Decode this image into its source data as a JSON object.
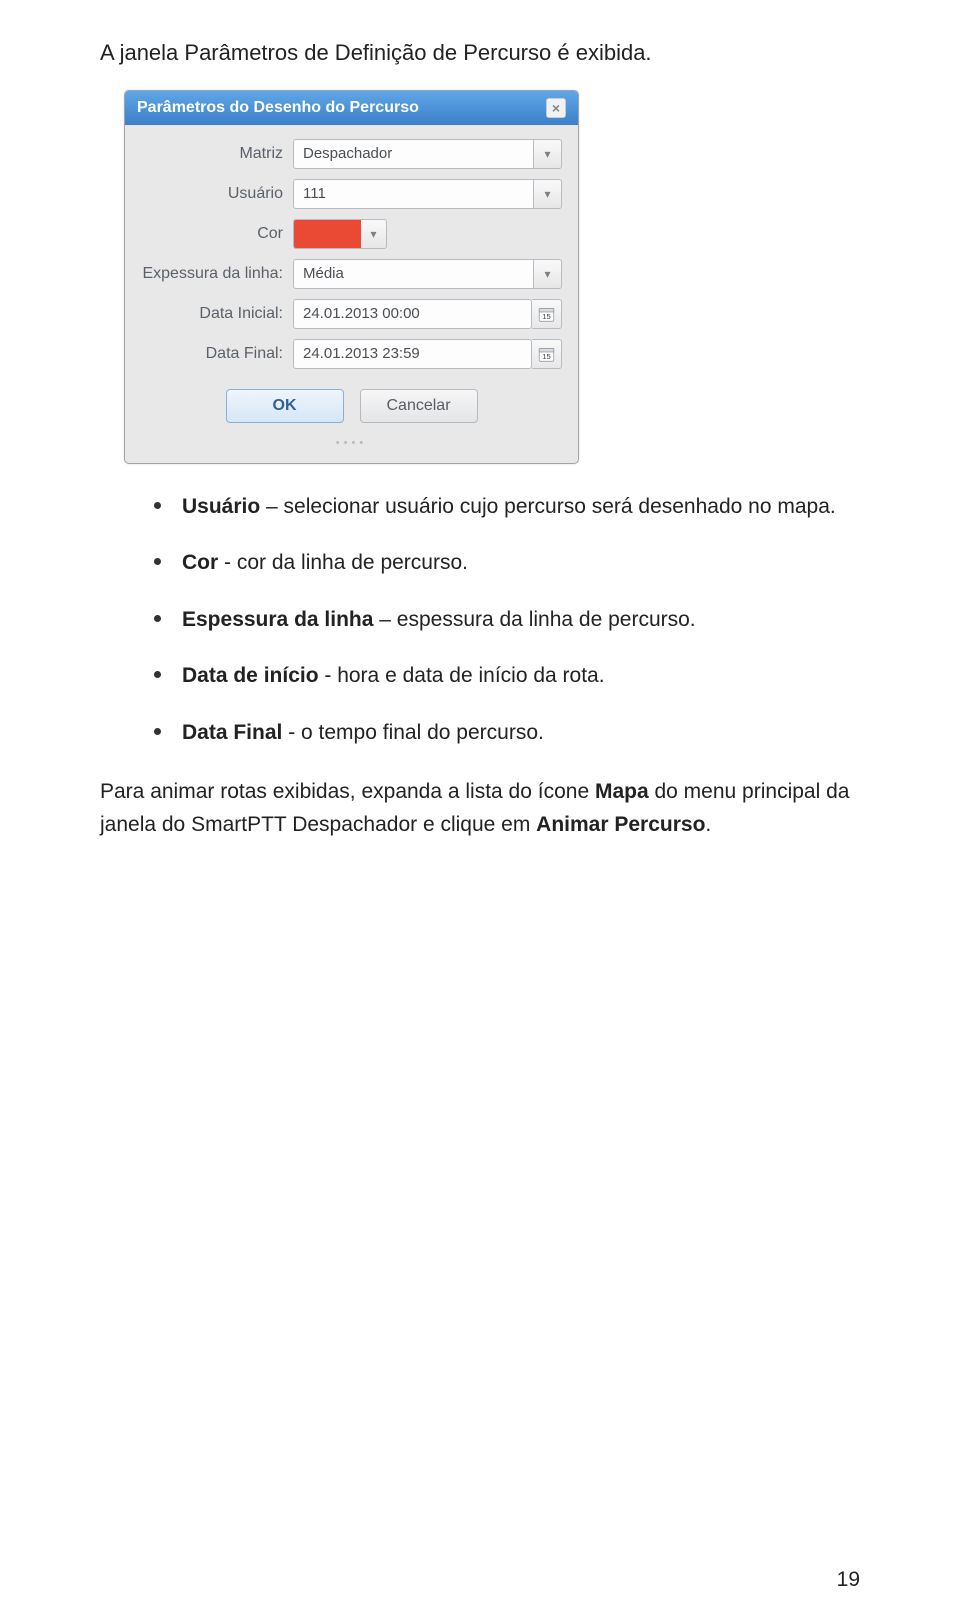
{
  "heading": "A janela Parâmetros de Definição de Percurso é exibida.",
  "dialog": {
    "title": "Parâmetros do Desenho do Percurso",
    "close": "×",
    "labels": {
      "matriz": "Matriz",
      "usuario": "Usuário",
      "cor": "Cor",
      "espessura": "Expessura da linha:",
      "data_inicial": "Data Inicial:",
      "data_final": "Data Final:"
    },
    "values": {
      "matriz": "Despachador",
      "usuario": "111",
      "espessura": "Média",
      "data_inicial": "24.01.2013 00:00",
      "data_final": "24.01.2013 23:59"
    },
    "color_hex": "#ea4a33",
    "cal_day": "15",
    "buttons": {
      "ok": "OK",
      "cancel": "Cancelar"
    }
  },
  "bullets": [
    {
      "term": "Usuário",
      "sep": " – ",
      "rest": "selecionar usuário cujo percurso será desenhado no mapa."
    },
    {
      "term": "Cor",
      "sep": " - ",
      "rest": "cor da linha de percurso."
    },
    {
      "term": "Espessura da linha",
      "sep": " – ",
      "rest": "espessura da linha de percurso."
    },
    {
      "term": "Data de início",
      "sep": " - ",
      "rest": "hora e data de início da rota."
    },
    {
      "term": "Data Final",
      "sep": " - ",
      "rest": "o tempo final do percurso."
    }
  ],
  "paragraph": {
    "p1": "Para animar rotas exibidas, expanda a lista do ícone ",
    "bold1": "Mapa",
    "p2": " do menu principal da janela do SmartPTT Despachador e clique em ",
    "bold2": "Animar Percurso",
    "p3": "."
  },
  "page_number": "19"
}
